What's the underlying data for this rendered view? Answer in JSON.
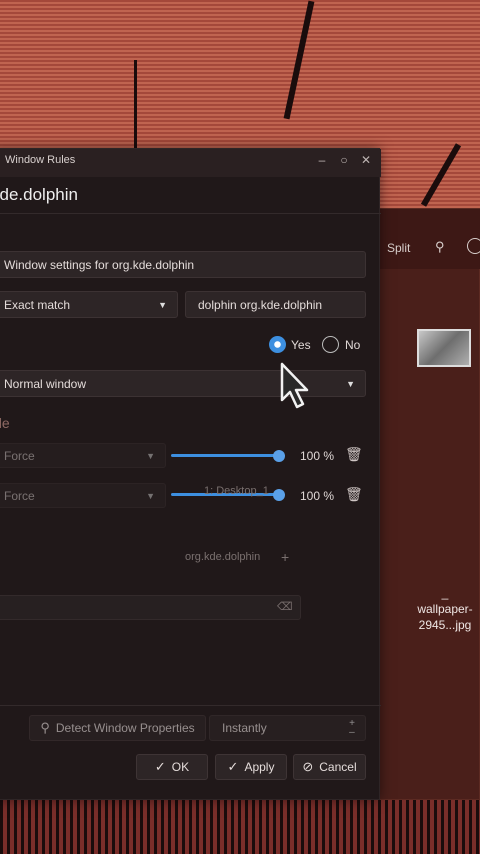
{
  "dolphin": {
    "split_label": "Split",
    "search_icon": "search-icon",
    "more_icon": "more-icon",
    "file_name_prefix": "_",
    "file_name": "wallpaper-2945...jpg"
  },
  "dialog": {
    "title": "Window Rules",
    "header": "kde.dolphin",
    "description_value": "Window settings for org.kde.dolphin",
    "match_type": "Exact match",
    "match_value": "dolphin org.kde.dolphin",
    "radio_yes": "Yes",
    "radio_no": "No",
    "window_type": "Normal window",
    "section_label": "ule",
    "rule1_policy": "Force",
    "rule1_value": "100 %",
    "rule2_policy": "Force",
    "rule2_value": "100 %",
    "ghost_desktop": "1: Desktop_1",
    "ghost_class": "org.kde.dolphin",
    "detect_label": "Detect Window Properties",
    "detect_delay": "Instantly",
    "ok_label": "OK",
    "apply_label": "Apply",
    "cancel_label": "Cancel"
  },
  "colors": {
    "accent": "#3d8fe0",
    "dialog_bg": "#201819"
  }
}
